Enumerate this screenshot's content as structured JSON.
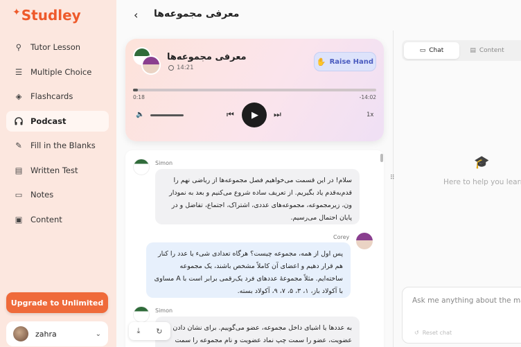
{
  "app": {
    "name": "Studley"
  },
  "sidebar": {
    "items": [
      {
        "label": "Tutor Lesson",
        "icon": "tutor-lesson-icon",
        "glyph": "⚲"
      },
      {
        "label": "Multiple Choice",
        "icon": "list-check-icon",
        "glyph": "☰"
      },
      {
        "label": "Flashcards",
        "icon": "layers-icon",
        "glyph": "◈"
      },
      {
        "label": "Podcast",
        "icon": "headphones-icon",
        "glyph": "🎧"
      },
      {
        "label": "Fill in the Blanks",
        "icon": "pencil-icon",
        "glyph": "✎"
      },
      {
        "label": "Written Test",
        "icon": "written-test-icon",
        "glyph": "▤"
      },
      {
        "label": "Notes",
        "icon": "notes-icon",
        "glyph": "▭"
      },
      {
        "label": "Content",
        "icon": "content-icon",
        "glyph": "▣"
      }
    ],
    "active_index": 3,
    "upgrade_label": "Upgrade to Unlimited",
    "user": {
      "name": "zahra"
    }
  },
  "header": {
    "title": "معرفی مجموعه‌ها"
  },
  "player": {
    "title": "معرفی مجموعه‌ها",
    "duration": "14:21",
    "raise_hand_label": "Raise Hand",
    "elapsed": "0:18",
    "remaining": "-14:02",
    "progress": 0.02,
    "speed": "1x"
  },
  "transcript": [
    {
      "speaker": "Simon",
      "text": "سلام! در این قسمت می‌خواهیم فصل مجموعه‌ها از ریاضی نهم را قدم‌به‌قدم یاد بگیریم. از تعریف ساده شروع می‌کنیم و بعد به نمودار ون، زیرمجموعه، مجموعه‌های عددی، اشتراک، اجتماع، تفاضل و در پایان احتمال می‌رسیم."
    },
    {
      "speaker": "Corey",
      "text": "پس اول از همه، مجموعه چیست؟ هرگاه تعدادی شیء یا عدد را کنار هم قرار دهیم و اعضای آن کاملاً مشخص باشند، یک مجموعه ساخته‌ایم. مثلاً مجموعهٔ عددهای فرد یک‌رقمی برابر است با A مساوی با آکولاد باز، ۱، ۳، ۵، ۷، ۹، آکولاد بسته."
    },
    {
      "speaker": "Simon",
      "text": "به عددها یا اشیای داخل مجموعه، عضو می‌گوییم. برای نشان دادن عضویت، عضو را سمت چپ نماد عضویت و نام مجموعه را سمت"
    }
  ],
  "right_panel": {
    "tabs": [
      {
        "label": "Chat"
      },
      {
        "label": "Content"
      }
    ],
    "help_text": "Here to help you learn",
    "input_placeholder": "Ask me anything about the material",
    "reset_label": "Reset chat"
  }
}
